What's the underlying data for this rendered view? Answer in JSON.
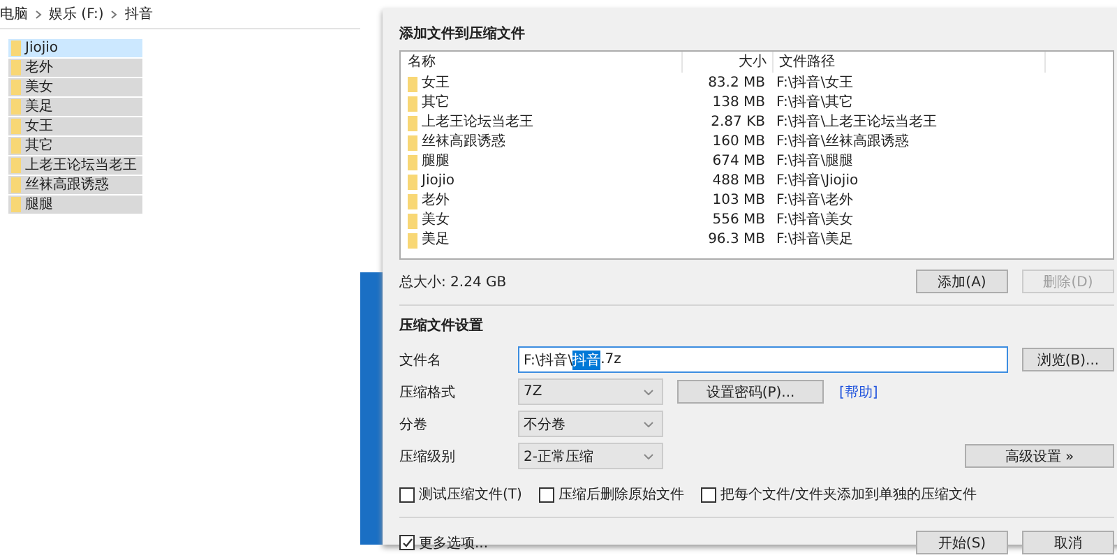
{
  "explorer": {
    "breadcrumb": [
      "电脑",
      "娱乐 (F:)",
      "抖音"
    ],
    "items": [
      {
        "name": "Jiojio",
        "selected": true
      },
      {
        "name": "老外",
        "selected": false
      },
      {
        "name": "美女",
        "selected": false
      },
      {
        "name": "美足",
        "selected": false
      },
      {
        "name": "女王",
        "selected": false
      },
      {
        "name": "其它",
        "selected": false
      },
      {
        "name": "上老王论坛当老王",
        "selected": false
      },
      {
        "name": "丝袜高跟诱惑",
        "selected": false
      },
      {
        "name": "腿腿",
        "selected": false
      }
    ]
  },
  "dialog": {
    "section_title": "添加文件到压缩文件",
    "table": {
      "columns": [
        "名称",
        "大小",
        "文件路径"
      ],
      "rows": [
        [
          "女王",
          "83.2 MB",
          "F:\\抖音\\女王"
        ],
        [
          "其它",
          "138 MB",
          "F:\\抖音\\其它"
        ],
        [
          "上老王论坛当老王",
          "2.87 KB",
          "F:\\抖音\\上老王论坛当老王"
        ],
        [
          "丝袜高跟诱惑",
          "160 MB",
          "F:\\抖音\\丝袜高跟诱惑"
        ],
        [
          "腿腿",
          "674 MB",
          "F:\\抖音\\腿腿"
        ],
        [
          "Jiojio",
          "488 MB",
          "F:\\抖音\\Jiojio"
        ],
        [
          "老外",
          "103 MB",
          "F:\\抖音\\老外"
        ],
        [
          "美女",
          "556 MB",
          "F:\\抖音\\美女"
        ],
        [
          "美足",
          "96.3 MB",
          "F:\\抖音\\美足"
        ]
      ]
    },
    "total_size": "总大小: 2.24 GB",
    "list_buttons": [
      {
        "label": "添加(A)",
        "disabled": false
      },
      {
        "label": "删除(D)",
        "disabled": true
      }
    ],
    "settings_title": "压缩文件设置",
    "file_name": {
      "label": "文件名",
      "prefix": "F:\\抖音\\",
      "selection": "抖音",
      "suffix": ".7z",
      "browse_button": "浏览(B)..."
    },
    "format": {
      "label": "压缩格式",
      "value": "7Z",
      "password_button": "设置密码(P)...",
      "help_link": "[帮助]"
    },
    "split": {
      "label": "分卷",
      "value": "不分卷"
    },
    "level": {
      "label": "压缩级别",
      "value": "2-正常压缩",
      "advanced_button": "高级设置 »"
    },
    "options": [
      {
        "label": "测试压缩文件(T)",
        "checked": false
      },
      {
        "label": "压缩后删除原始文件",
        "checked": false
      },
      {
        "label": "把每个文件/文件夹添加到单独的压缩文件",
        "checked": false
      }
    ],
    "more_options": {
      "label": "更多选项...",
      "checked": true
    },
    "buttons": [
      "开始(S)",
      "取消"
    ]
  }
}
